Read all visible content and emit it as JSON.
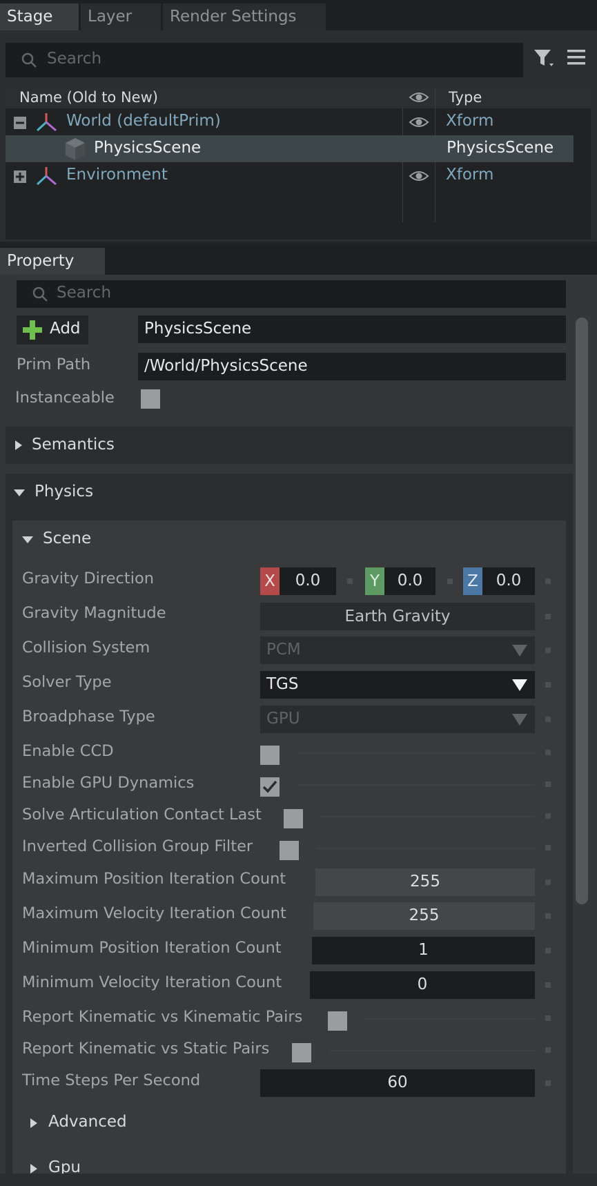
{
  "tabs": [
    "Stage",
    "Layer",
    "Render Settings"
  ],
  "stage": {
    "search_placeholder": "Search",
    "columns": {
      "name": "Name (Old to New)",
      "type": "Type"
    },
    "rows": [
      {
        "name": "World (defaultPrim)",
        "type": "Xform"
      },
      {
        "name": "PhysicsScene",
        "type": "PhysicsScene"
      },
      {
        "name": "Environment",
        "type": "Xform"
      }
    ]
  },
  "property": {
    "tab": "Property",
    "search_placeholder": "Search",
    "add_label": "Add",
    "prim_name": "PhysicsScene",
    "prim_path_label": "Prim Path",
    "prim_path": "/World/PhysicsScene",
    "instanceable_label": "Instanceable",
    "sections": {
      "semantics": "Semantics",
      "physics": "Physics",
      "scene": "Scene",
      "advanced": "Advanced",
      "gpu": "Gpu"
    },
    "gravity_direction": {
      "label": "Gravity Direction",
      "x_label": "X",
      "x": "0.0",
      "y_label": "Y",
      "y": "0.0",
      "z_label": "Z",
      "z": "0.0"
    },
    "gravity_magnitude": {
      "label": "Gravity Magnitude",
      "value": "Earth Gravity"
    },
    "collision_system": {
      "label": "Collision System",
      "value": "PCM"
    },
    "solver_type": {
      "label": "Solver Type",
      "value": "TGS"
    },
    "broadphase_type": {
      "label": "Broadphase Type",
      "value": "GPU"
    },
    "enable_ccd": {
      "label": "Enable CCD",
      "checked": false
    },
    "enable_gpu_dynamics": {
      "label": "Enable GPU Dynamics",
      "checked": true
    },
    "solve_articulation": {
      "label": "Solve Articulation Contact Last",
      "checked": false
    },
    "inverted_collision": {
      "label": "Inverted Collision Group Filter",
      "checked": false
    },
    "max_pos_iter": {
      "label": "Maximum Position Iteration Count",
      "value": "255"
    },
    "max_vel_iter": {
      "label": "Maximum Velocity Iteration Count",
      "value": "255"
    },
    "min_pos_iter": {
      "label": "Minimum Position Iteration Count",
      "value": "1"
    },
    "min_vel_iter": {
      "label": "Minimum Velocity Iteration Count",
      "value": "0"
    },
    "report_kin_kin": {
      "label": "Report Kinematic vs Kinematic Pairs",
      "checked": false
    },
    "report_kin_static": {
      "label": "Report Kinematic vs Static Pairs",
      "checked": false
    },
    "time_steps": {
      "label": "Time Steps Per Second",
      "value": "60"
    }
  },
  "colors": {
    "x_axis": "#b44a4a",
    "y_axis": "#5e9a63",
    "z_axis": "#4a77a3",
    "selection": "#3d4749"
  }
}
